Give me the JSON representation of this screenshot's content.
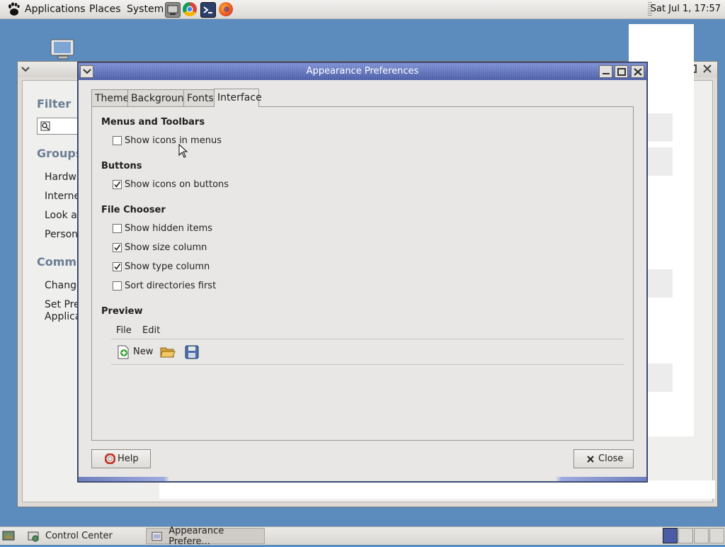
{
  "top_panel": {
    "menus": [
      "Applications",
      "Places",
      "System"
    ],
    "launchers": [
      "file-manager-icon",
      "chrome-icon",
      "terminal-icon",
      "firefox-icon"
    ],
    "clock": "Sat Jul  1, 17:57"
  },
  "control_center": {
    "filter_label": "Filter",
    "groups_label": "Groups",
    "group_items": [
      "Hardwa",
      "Internet",
      "Look an",
      "Persona"
    ],
    "common_label": "Commo",
    "common_items": [
      "Change",
      "Set Pref",
      "Applicat"
    ]
  },
  "dialog": {
    "title": "Appearance Preferences",
    "tabs": [
      "Theme",
      "Background",
      "Fonts",
      "Interface"
    ],
    "active_tab": "Interface",
    "sections": {
      "menus_toolbars": {
        "heading": "Menus and Toolbars",
        "options": [
          {
            "label": "Show icons in menus",
            "checked": false
          }
        ]
      },
      "buttons": {
        "heading": "Buttons",
        "options": [
          {
            "label": "Show icons on buttons",
            "checked": true
          }
        ]
      },
      "file_chooser": {
        "heading": "File Chooser",
        "options": [
          {
            "label": "Show hidden items",
            "checked": false
          },
          {
            "label": "Show size column",
            "checked": true
          },
          {
            "label": "Show type column",
            "checked": true
          },
          {
            "label": "Sort directories first",
            "checked": false
          }
        ]
      },
      "preview": {
        "heading": "Preview",
        "menus": [
          "File",
          "Edit"
        ],
        "toolbar_new": "New"
      }
    },
    "help_button": "Help",
    "close_button": "Close"
  },
  "bottom_panel": {
    "tasks": [
      "Control Center",
      "Appearance Prefere..."
    ]
  },
  "colors": {
    "desktop": "#5b8cbd",
    "titlebar_active": "#4a5ca6",
    "heading_blue": "#6b7d93"
  }
}
